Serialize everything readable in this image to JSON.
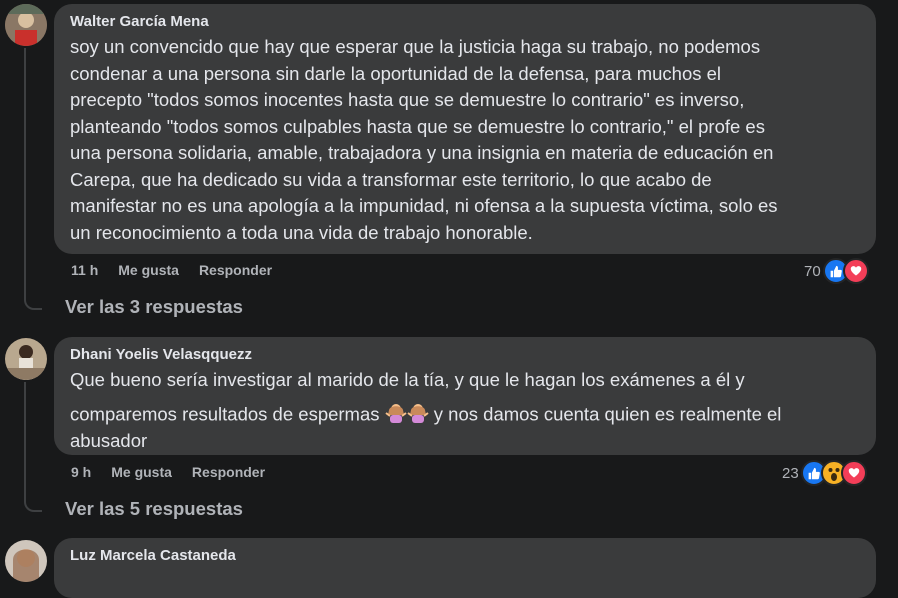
{
  "comments": [
    {
      "author": "Walter García Mena",
      "text": "soy un convencido que hay que esperar que la justicia haga su trabajo, no podemos\ncondenar a una persona sin darle la oportunidad de la defensa, para muchos el\nprecepto \"todos somos inocentes hasta que se demuestre lo contrario\" es inverso,\nplanteando \"todos somos culpables hasta que se demuestre lo contrario,\" el profe es\nuna persona solidaria, amable, trabajadora y una insignia en materia de educación en\nCarepa, que ha dedicado su vida a transformar este territorio, lo que acabo de\nmanifestar no es una apología a la impunidad, ni ofensa a la supuesta víctima, solo es\nun reconocimiento a toda una vida de trabajo honorable.",
      "time": "11 h",
      "like_label": "Me gusta",
      "reply_label": "Responder",
      "reaction_count": "70",
      "reactions": [
        "like-icon",
        "love-icon"
      ],
      "replies_label": "Ver las 3 respuestas"
    },
    {
      "author": "Dhani Yoelis Velasqquezz",
      "text_part1": "Que bueno sería investigar al marido de la tía, y que le hagan los exámenes a él y\ncomparemos resultados de espermas ",
      "text_emoji": "🤷‍♀️🤷‍♀️",
      "text_part2": " y nos damos cuenta quien es realmente el\nabusador",
      "time": "9 h",
      "like_label": "Me gusta",
      "reply_label": "Responder",
      "reaction_count": "23",
      "reactions": [
        "like-icon",
        "wow-icon",
        "love-icon"
      ],
      "replies_label": "Ver las 5 respuestas"
    },
    {
      "author": "Luz Marcela Castaneda"
    }
  ]
}
